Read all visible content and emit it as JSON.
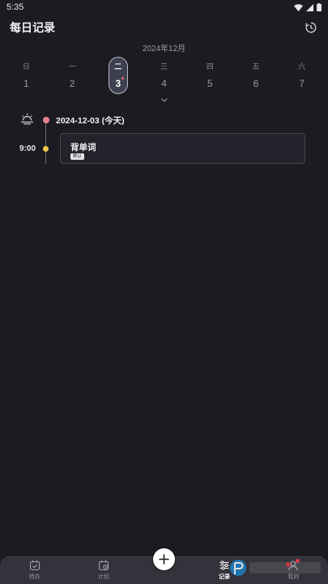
{
  "status_bar": {
    "time": "5:35"
  },
  "header": {
    "title": "每日记录"
  },
  "calendar": {
    "month_label": "2024年12月",
    "days": [
      {
        "weekday": "日",
        "num": "1"
      },
      {
        "weekday": "一",
        "num": "2"
      },
      {
        "weekday": "二",
        "num": "3",
        "selected": true
      },
      {
        "weekday": "三",
        "num": "4"
      },
      {
        "weekday": "四",
        "num": "5"
      },
      {
        "weekday": "五",
        "num": "6"
      },
      {
        "weekday": "六",
        "num": "7"
      }
    ]
  },
  "timeline": {
    "date_heading": "2024-12-03 (今天)",
    "tasks": [
      {
        "time": "9:00",
        "title": "背单词",
        "tag": "默认"
      }
    ]
  },
  "bottom_nav": {
    "items": [
      {
        "label": "待办"
      },
      {
        "label": "计划"
      },
      {
        "label": "记录"
      },
      {
        "label": "我的"
      }
    ]
  },
  "colors": {
    "background": "#1c1b22",
    "accent_start": "#e6828f",
    "task_dot": "#f2c84b",
    "badge": "#e53b4a"
  }
}
